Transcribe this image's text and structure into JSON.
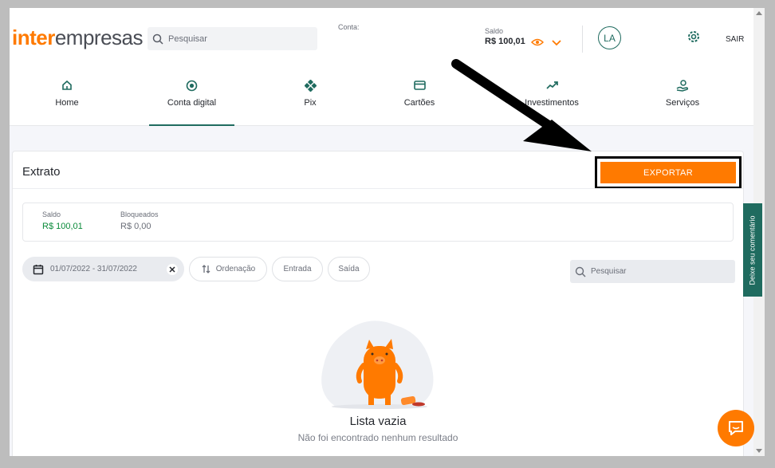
{
  "brand": {
    "part1": "inter",
    "part2": "empresas"
  },
  "header": {
    "search_placeholder": "Pesquisar",
    "conta_label": "Conta:",
    "saldo_label": "Saldo",
    "saldo_value": "R$ 100,01",
    "avatar_initials": "LA",
    "logout_label": "SAIR"
  },
  "nav": [
    {
      "label": "Home",
      "icon": "home-icon"
    },
    {
      "label": "Conta digital",
      "icon": "coin-icon"
    },
    {
      "label": "Pix",
      "icon": "pix-icon"
    },
    {
      "label": "Cartões",
      "icon": "card-icon"
    },
    {
      "label": "Investimentos",
      "icon": "chart-up-icon"
    },
    {
      "label": "Serviços",
      "icon": "hand-coin-icon"
    }
  ],
  "extrato": {
    "title": "Extrato",
    "export_label": "EXPORTAR",
    "saldo_label": "Saldo",
    "saldo_value": "R$ 100,01",
    "bloqueados_label": "Bloqueados",
    "bloqueados_value": "R$ 0,00",
    "date_range": "01/07/2022 - 31/07/2022",
    "ordenacao_label": "Ordenação",
    "entrada_label": "Entrada",
    "saida_label": "Saída",
    "search_placeholder": "Pesquisar",
    "empty_title": "Lista vazia",
    "empty_subtitle": "Não foi encontrado nenhum resultado"
  },
  "feedback_label": "Deixe seu comentário",
  "colors": {
    "accent": "#ff7a00",
    "brand_green": "#1f6b5f",
    "positive": "#0a8a3a"
  }
}
